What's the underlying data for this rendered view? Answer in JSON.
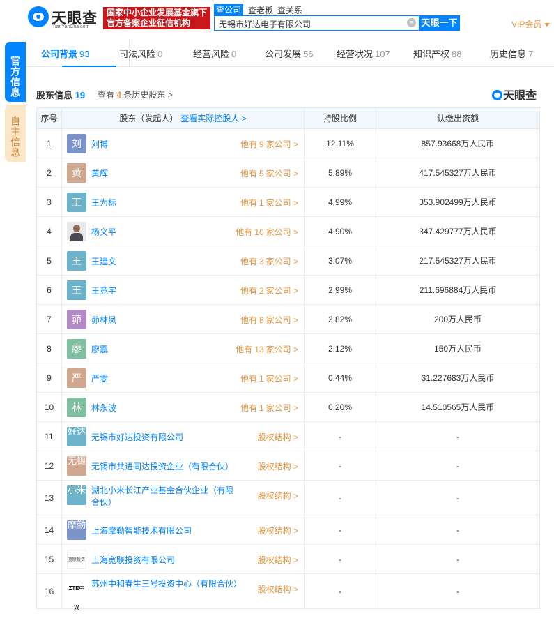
{
  "header": {
    "logo_text": "天眼查",
    "logo_sub": "TianYanCha.com",
    "promo_line1": "国家中小企业发展基金旗下",
    "promo_line2": "官方备案企业征信机构",
    "search_tabs": [
      "查公司",
      "查老板",
      "查关系"
    ],
    "search_value": "无锡市好达电子有限公司",
    "clear_glyph": "×",
    "search_button": "天眼一下",
    "vip_label": "VIP会员"
  },
  "side_tabs": [
    "官方信息",
    "自主信息"
  ],
  "nav": [
    {
      "label": "公司背景",
      "count": "93"
    },
    {
      "label": "司法风险",
      "count": "0"
    },
    {
      "label": "经营风险",
      "count": "0"
    },
    {
      "label": "公司发展",
      "count": "56"
    },
    {
      "label": "经营状况",
      "count": "107"
    },
    {
      "label": "知识产权",
      "count": "88"
    },
    {
      "label": "历史信息",
      "count": "7"
    }
  ],
  "section": {
    "title": "股东信息",
    "count": "19",
    "history_prefix": "查看",
    "history_count": "4",
    "history_suffix": "条历史股东 >",
    "watermark": "天眼查"
  },
  "table": {
    "headers": {
      "index": "序号",
      "holder": "股东（发起人）",
      "holder_action": "查看实际控股人 >",
      "ratio": "持股比例",
      "capital": "认缴出资额"
    },
    "rows": [
      {
        "index": "1",
        "avatar": "刘",
        "avatar_color": "#7b93c8",
        "name": "刘博",
        "link_pre": "他有",
        "link_n": "9",
        "link_post": "家公司 >",
        "ratio": "12.11%",
        "capital": "857.93668万人民币"
      },
      {
        "index": "2",
        "avatar": "黄",
        "avatar_color": "#cfa78f",
        "name": "黄辉",
        "link_pre": "他有",
        "link_n": "5",
        "link_post": "家公司 >",
        "ratio": "5.89%",
        "capital": "417.545327万人民币"
      },
      {
        "index": "3",
        "avatar": "王",
        "avatar_color": "#6cb2c9",
        "name": "王为标",
        "link_pre": "他有",
        "link_n": "1",
        "link_post": "家公司 >",
        "ratio": "4.99%",
        "capital": "353.902499万人民币"
      },
      {
        "index": "4",
        "avatar": "",
        "avatar_color": "photo",
        "name": "杨义平",
        "link_pre": "他有",
        "link_n": "10",
        "link_post": "家公司 >",
        "ratio": "4.90%",
        "capital": "347.429777万人民币"
      },
      {
        "index": "5",
        "avatar": "王",
        "avatar_color": "#6cb2c9",
        "name": "王建文",
        "link_pre": "他有",
        "link_n": "3",
        "link_post": "家公司 >",
        "ratio": "3.07%",
        "capital": "217.545327万人民币"
      },
      {
        "index": "6",
        "avatar": "王",
        "avatar_color": "#6cb2c9",
        "name": "王竞宇",
        "link_pre": "他有",
        "link_n": "2",
        "link_post": "家公司 >",
        "ratio": "2.99%",
        "capital": "211.696884万人民币"
      },
      {
        "index": "7",
        "avatar": "茆",
        "avatar_color": "#b28bc5",
        "name": "茆林凤",
        "link_pre": "他有",
        "link_n": "8",
        "link_post": "家公司 >",
        "ratio": "2.82%",
        "capital": "200万人民币"
      },
      {
        "index": "8",
        "avatar": "廖",
        "avatar_color": "#80c0a0",
        "name": "廖震",
        "link_pre": "他有",
        "link_n": "13",
        "link_post": "家公司 >",
        "ratio": "2.12%",
        "capital": "150万人民币"
      },
      {
        "index": "9",
        "avatar": "严",
        "avatar_color": "#cfa78f",
        "name": "严雯",
        "link_pre": "他有",
        "link_n": "1",
        "link_post": "家公司 >",
        "ratio": "0.44%",
        "capital": "31.227683万人民币"
      },
      {
        "index": "10",
        "avatar": "林",
        "avatar_color": "#80c0a0",
        "name": "林永波",
        "link_pre": "他有",
        "link_n": "1",
        "link_post": "家公司 >",
        "ratio": "0.20%",
        "capital": "14.510565万人民币"
      },
      {
        "index": "11",
        "avatar": "好达",
        "avatar_color": "#6cb2c9",
        "name": "无锡市好达投资有限公司",
        "link_pre": "股权结构 >",
        "link_n": "",
        "link_post": "",
        "ratio": "-",
        "capital": "-"
      },
      {
        "index": "12",
        "avatar": "无锡",
        "avatar_color": "#cfa78f",
        "name": "无锡市共进同达投资企业（有限合伙）",
        "link_pre": "股权结构 >",
        "link_n": "",
        "link_post": "",
        "ratio": "-",
        "capital": "-"
      },
      {
        "index": "13",
        "avatar": "小米",
        "avatar_color": "#6cb2c9",
        "name": "湖北小米长江产业基金合伙企业（有限合伙）",
        "link_pre": "股权结构 >",
        "link_n": "",
        "link_post": "",
        "ratio": "-",
        "capital": "-"
      },
      {
        "index": "14",
        "avatar": "摩勤",
        "avatar_color": "#7b93c8",
        "name": "上海摩勤智能技术有限公司",
        "link_pre": "股权结构 >",
        "link_n": "",
        "link_post": "",
        "ratio": "-",
        "capital": "-"
      },
      {
        "index": "15",
        "avatar": "宽联投资",
        "avatar_color": "logo1",
        "name": "上海宽联投资有限公司",
        "link_pre": "股权结构 >",
        "link_n": "",
        "link_post": "",
        "ratio": "-",
        "capital": "-"
      },
      {
        "index": "16",
        "avatar": "ZTE中兴",
        "avatar_color": "logo2",
        "name": "苏州中和春生三号投资中心（有限合伙）",
        "link_pre": "股权结构 >",
        "link_n": "",
        "link_post": "",
        "ratio": "-",
        "capital": "-"
      }
    ]
  }
}
